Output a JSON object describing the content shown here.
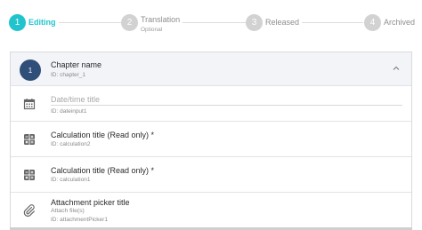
{
  "stepper": {
    "steps": [
      {
        "number": "1",
        "label": "Editing",
        "sub": "",
        "state": "active"
      },
      {
        "number": "2",
        "label": "Translation",
        "sub": "Optional",
        "state": "inactive"
      },
      {
        "number": "3",
        "label": "Released",
        "sub": "",
        "state": "inactive"
      },
      {
        "number": "4",
        "label": "Archived",
        "sub": "",
        "state": "inactive"
      }
    ]
  },
  "chapter": {
    "number": "1",
    "title": "Chapter name",
    "id_text": "ID: chapter_1",
    "icon": "chevron-up-icon"
  },
  "fields": {
    "date": {
      "placeholder": "Date/time title",
      "id_text": "ID: dateinput1",
      "icon": "calendar-icon"
    },
    "calc2": {
      "title": "Calculation title (Read only) *",
      "id_text": "ID: calculation2",
      "icon": "calculator-icon"
    },
    "calc1": {
      "title": "Calculation title (Read only) *",
      "id_text": "ID: calculation1",
      "icon": "calculator-icon"
    },
    "attachment": {
      "title": "Attachment picker title",
      "hint": "Attach file(s)",
      "id_text": "ID: attachmentPicker1",
      "icon": "paperclip-icon"
    }
  },
  "colors": {
    "accent": "#20c4cd",
    "inactive": "#d2d2d2",
    "chapter_badge": "#2f4e78",
    "header_bg": "#f3f4f8"
  }
}
